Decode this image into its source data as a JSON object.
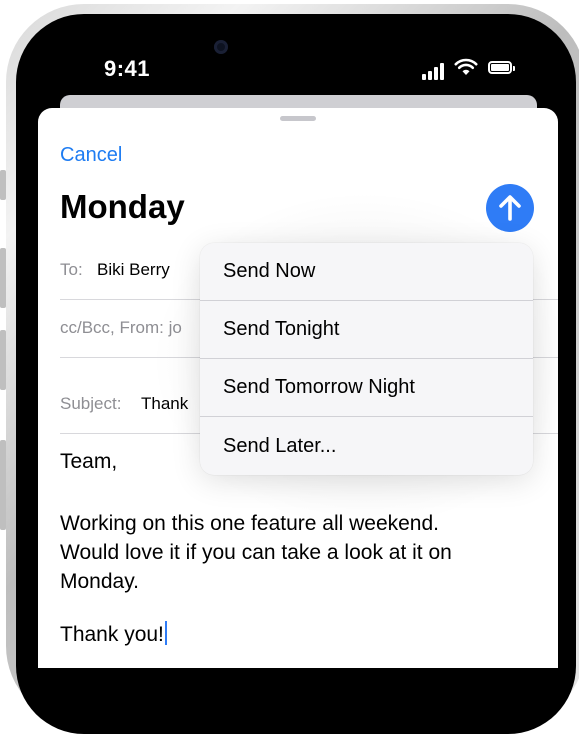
{
  "status_bar": {
    "time": "9:41"
  },
  "compose": {
    "cancel_label": "Cancel",
    "title": "Monday",
    "to_label": "To:",
    "to_value": "Biki Berry",
    "cc_label": "cc/Bcc, From: jo",
    "subject_label": "Subject:",
    "subject_value": "Thank",
    "body": {
      "greeting": "Team,",
      "line1": "Working on this one feature all weekend.",
      "line2": "Would love it if you can take a look at it on",
      "line3": "Monday.",
      "closing": "Thank you!"
    }
  },
  "send_menu": {
    "items": [
      {
        "label": "Send Now"
      },
      {
        "label": "Send Tonight"
      },
      {
        "label": "Send Tomorrow Night"
      },
      {
        "label": "Send Later..."
      }
    ]
  },
  "colors": {
    "accent": "#2f7cf6",
    "link": "#1e7cf2"
  },
  "icons": [
    "wifi-icon",
    "battery-icon",
    "signal-icon",
    "arrow-up-icon"
  ]
}
